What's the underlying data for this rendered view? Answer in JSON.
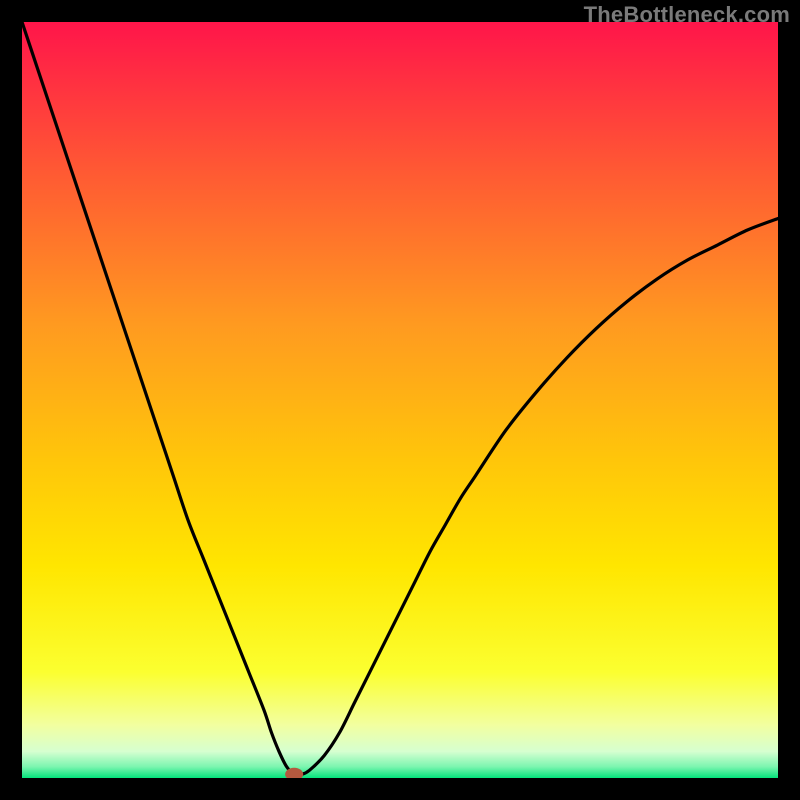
{
  "watermark": "TheBottleneck.com",
  "colors": {
    "frame": "#000000",
    "curve": "#000000",
    "marker": "#b4593f",
    "gradient_top": "#ff154a",
    "gradient_mid_upper": "#ff8a2a",
    "gradient_mid": "#ffe300",
    "gradient_mid_lower": "#f8ff6a",
    "gradient_low": "#eaffc0",
    "gradient_bottom": "#04e47c"
  },
  "chart_data": {
    "type": "line",
    "title": "",
    "xlabel": "",
    "ylabel": "",
    "xlim": [
      0,
      100
    ],
    "ylim": [
      0,
      100
    ],
    "x": [
      0,
      2,
      4,
      6,
      8,
      10,
      12,
      14,
      16,
      18,
      20,
      22,
      24,
      26,
      28,
      30,
      32,
      33,
      34,
      35,
      36,
      37,
      38,
      40,
      42,
      44,
      46,
      48,
      50,
      52,
      54,
      56,
      58,
      60,
      64,
      68,
      72,
      76,
      80,
      84,
      88,
      92,
      96,
      100
    ],
    "values": [
      100,
      94,
      88,
      82,
      76,
      70,
      64,
      58,
      52,
      46,
      40,
      34,
      29,
      24,
      19,
      14,
      9,
      6,
      3.5,
      1.5,
      0.5,
      0.5,
      1,
      3,
      6,
      10,
      14,
      18,
      22,
      26,
      30,
      33.5,
      37,
      40,
      46,
      51,
      55.5,
      59.5,
      63,
      66,
      68.5,
      70.5,
      72.5,
      74
    ],
    "marker": {
      "x": 36,
      "y": 0.5
    },
    "annotations": []
  }
}
